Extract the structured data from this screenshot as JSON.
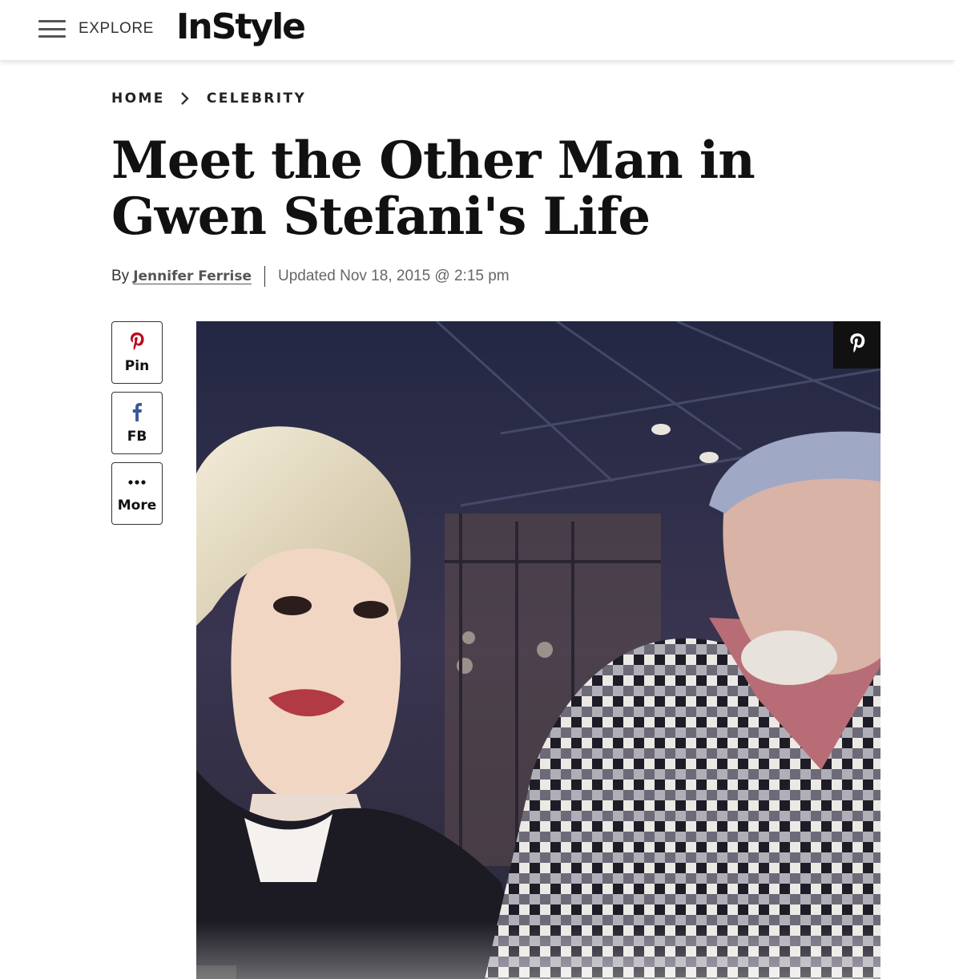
{
  "header": {
    "explore_label": "EXPLORE",
    "logo_text": "InStyle"
  },
  "breadcrumb": {
    "items": [
      "HOME",
      "CELEBRITY"
    ]
  },
  "article": {
    "title": "Meet the Other Man in Gwen Stefani's Life",
    "by_prefix": "By",
    "author": "Jennifer Ferrise",
    "updated": "Updated Nov 18, 2015 @ 2:15 pm"
  },
  "share": {
    "pin_label": "Pin",
    "fb_label": "FB",
    "more_label": "More"
  },
  "colors": {
    "pinterest_red": "#bd081c",
    "facebook_blue": "#3b5998",
    "photo_bg": "#2a2d4a"
  },
  "icons": [
    "menu-icon",
    "chevron-right-icon",
    "pinterest-icon",
    "facebook-icon",
    "more-dots-icon"
  ]
}
